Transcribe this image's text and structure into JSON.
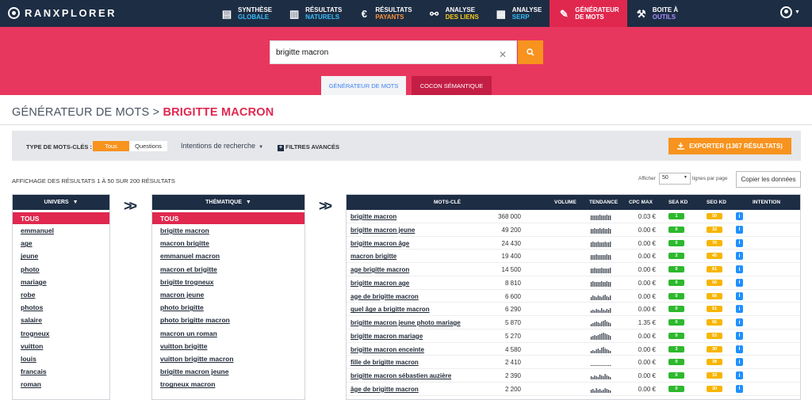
{
  "app": {
    "logo": "RANXPLORER"
  },
  "nav": [
    {
      "l1": "SYNTHÈSE",
      "l2": "GLOBALE",
      "icon": "report-icon"
    },
    {
      "l1": "RÉSULTATS",
      "l2": "NATURELS",
      "icon": "bar-chart-icon"
    },
    {
      "l1": "RÉSULTATS",
      "l2": "PAYANTS",
      "icon": "euro-icon"
    },
    {
      "l1": "ANALYSE",
      "l2": "DES LIENS",
      "icon": "link-icon"
    },
    {
      "l1": "ANALYSE",
      "l2": "SERP",
      "icon": "serp-chart-icon"
    },
    {
      "l1": "GÉNÉRATEUR",
      "l2": "DE MOTS",
      "icon": "pencil-icon"
    },
    {
      "l1": "BOITE À",
      "l2": "OUTILS",
      "icon": "wrench-icon"
    }
  ],
  "search": {
    "value": "brigitte macron"
  },
  "tabs": {
    "generator": "GÉNÉRATEUR DE MOTS",
    "cocon": "COCON SÉMANTIQUE"
  },
  "title": {
    "prefix": "GÉNÉRATEUR DE MOTS > ",
    "keyword": "BRIGITTE MACRON"
  },
  "filters": {
    "type_label": "TYPE DE MOTS-CLÉS :",
    "all": "Tous",
    "questions": "Questions",
    "intent": "Intentions de recherche",
    "advanced": "FILTRES AVANCÉS",
    "export": "EXPORTER  (1367 RÉSULTATS)"
  },
  "results_info": "AFFICHAGE DES RÉSULTATS 1 À 50 SUR 200 RÉSULTATS",
  "pagination": {
    "show": "Afficher",
    "per_page": "50",
    "lines": "lignes par page",
    "copy": "Copier les données"
  },
  "univers": {
    "header": "UNIVERS",
    "all": "TOUS",
    "items": [
      "emmanuel",
      "age",
      "jeune",
      "photo",
      "mariage",
      "robe",
      "photos",
      "salaire",
      "trogneux",
      "vuitton",
      "louis",
      "francais",
      "roman"
    ]
  },
  "thematique": {
    "header": "THÉMATIQUE",
    "all": "TOUS",
    "items": [
      "brigitte macron",
      "macron brigitte",
      "emmanuel macron",
      "macron et brigitte",
      "brigitte trogneux",
      "macron jeune",
      "photo brigitte",
      "photo brigitte macron",
      "macron un roman",
      "vuitton brigitte",
      "vuitton brigitte macron",
      "brigitte macron jeune",
      "trogneux macron"
    ]
  },
  "keywords": {
    "headers": {
      "kw": "MOTS-CLÉ",
      "volume": "VOLUME",
      "trend": "TENDANCE",
      "cpc": "CPC MAX",
      "sea": "SEA KD",
      "seo": "SEO KD",
      "intent": "INTENTION"
    },
    "rows": [
      {
        "kw": "brigitte macron",
        "volume": "368 000",
        "cpc": "0.03 €",
        "sea": "1",
        "seo": "50",
        "trend": [
          6,
          6,
          6,
          6,
          6,
          7,
          6,
          6,
          6,
          7,
          6,
          6
        ]
      },
      {
        "kw": "brigitte macron jeune",
        "volume": "49 200",
        "cpc": "0.00 €",
        "sea": "0",
        "seo": "32",
        "trend": [
          6,
          6,
          7,
          6,
          6,
          7,
          6,
          7,
          6,
          6,
          7,
          6
        ]
      },
      {
        "kw": "brigitte macron âge",
        "volume": "24 430",
        "cpc": "0.00 €",
        "sea": "0",
        "seo": "70",
        "trend": [
          6,
          7,
          6,
          6,
          7,
          6,
          6,
          6,
          7,
          6,
          6,
          7
        ]
      },
      {
        "kw": "macron brigitte",
        "volume": "19 400",
        "cpc": "0.00 €",
        "sea": "2",
        "seo": "45",
        "trend": [
          6,
          6,
          6,
          7,
          6,
          6,
          6,
          6,
          6,
          7,
          6,
          6
        ]
      },
      {
        "kw": "age brigitte macron",
        "volume": "14 500",
        "cpc": "0.00 €",
        "sea": "0",
        "seo": "61",
        "trend": [
          6,
          6,
          7,
          6,
          6,
          6,
          7,
          6,
          6,
          6,
          6,
          7
        ]
      },
      {
        "kw": "brigitte macron age",
        "volume": "8 810",
        "cpc": "0.00 €",
        "sea": "0",
        "seo": "66",
        "trend": [
          6,
          7,
          6,
          6,
          6,
          6,
          7,
          6,
          6,
          7,
          6,
          6
        ]
      },
      {
        "kw": "age de brigitte macron",
        "volume": "6 600",
        "cpc": "0.00 €",
        "sea": "0",
        "seo": "66",
        "trend": [
          4,
          6,
          5,
          4,
          6,
          5,
          4,
          6,
          7,
          5,
          4,
          6
        ]
      },
      {
        "kw": "quel âge a brigitte macron",
        "volume": "6 290",
        "cpc": "0.00 €",
        "sea": "0",
        "seo": "51",
        "trend": [
          3,
          4,
          3,
          5,
          4,
          3,
          6,
          4,
          3,
          5,
          4,
          6
        ]
      },
      {
        "kw": "brigitte macron jeune photo mariage",
        "volume": "5 870",
        "cpc": "1.35 €",
        "sea": "0",
        "seo": "66",
        "trend": [
          3,
          4,
          5,
          6,
          5,
          4,
          6,
          7,
          8,
          6,
          5,
          4
        ]
      },
      {
        "kw": "brigitte macron mariage",
        "volume": "5 270",
        "cpc": "0.00 €",
        "sea": "0",
        "seo": "53",
        "trend": [
          4,
          5,
          6,
          5,
          6,
          7,
          8,
          9,
          8,
          7,
          6,
          5
        ]
      },
      {
        "kw": "brigitte macron enceinte",
        "volume": "4 580",
        "cpc": "0.00 €",
        "sea": "3",
        "seo": "30",
        "trend": [
          3,
          4,
          3,
          5,
          6,
          4,
          7,
          8,
          6,
          5,
          4,
          3
        ]
      },
      {
        "kw": "fille de brigitte macron",
        "volume": "2 410",
        "cpc": "0.00 €",
        "sea": "0",
        "seo": "38",
        "trend": [
          1,
          1,
          1,
          1,
          1,
          1,
          1,
          1,
          1,
          1,
          1,
          1
        ]
      },
      {
        "kw": "brigitte macron sébastien auzière",
        "volume": "2 390",
        "cpc": "0.00 €",
        "sea": "0",
        "seo": "33",
        "trend": [
          4,
          3,
          5,
          4,
          3,
          6,
          5,
          4,
          7,
          5,
          4,
          3
        ]
      },
      {
        "kw": "âge de brigitte macron",
        "volume": "2 200",
        "cpc": "0.00 €",
        "sea": "0",
        "seo": "30",
        "trend": [
          4,
          5,
          3,
          6,
          4,
          5,
          3,
          4,
          6,
          5,
          4,
          3
        ]
      }
    ]
  }
}
